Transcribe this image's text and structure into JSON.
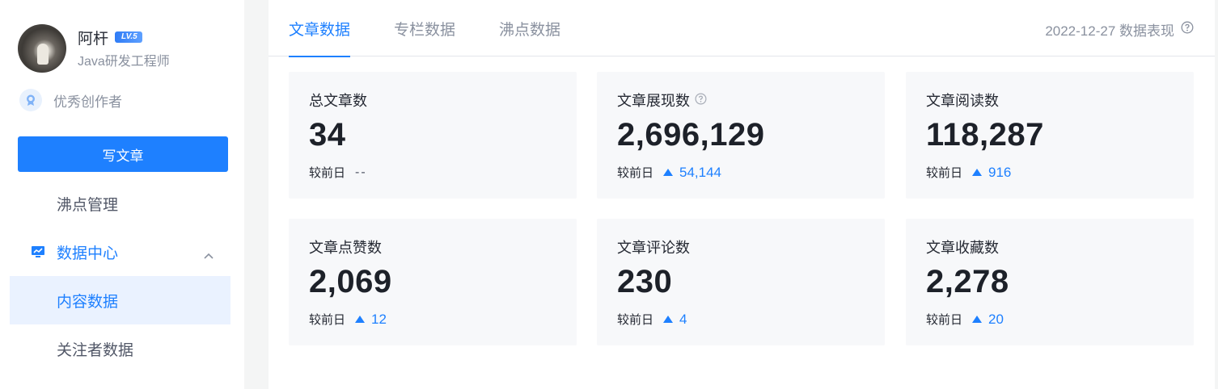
{
  "sidebar": {
    "user": {
      "name": "阿杆",
      "level": "LV.5",
      "title": "Java研发工程师"
    },
    "honor": "优秀创作者",
    "write_button": "写文章",
    "nav": {
      "pins": "沸点管理",
      "data_center": "数据中心",
      "content_data": "内容数据",
      "follower_data": "关注者数据"
    }
  },
  "tabs": [
    "文章数据",
    "专栏数据",
    "沸点数据"
  ],
  "active_tab": 0,
  "date_info": "2022-12-27 数据表现",
  "compare_label": "较前日",
  "cards": [
    {
      "title": "总文章数",
      "value": "34",
      "delta": "--",
      "trend": "flat"
    },
    {
      "title": "文章展现数",
      "value": "2,696,129",
      "delta": "54,144",
      "trend": "up"
    },
    {
      "title": "文章阅读数",
      "value": "118,287",
      "delta": "916",
      "trend": "up"
    },
    {
      "title": "文章点赞数",
      "value": "2,069",
      "delta": "12",
      "trend": "up"
    },
    {
      "title": "文章评论数",
      "value": "230",
      "delta": "4",
      "trend": "up"
    },
    {
      "title": "文章收藏数",
      "value": "2,278",
      "delta": "20",
      "trend": "up"
    }
  ],
  "colors": {
    "accent": "#1e80ff",
    "card_bg": "#f7f8fa",
    "muted": "#8a919f"
  }
}
